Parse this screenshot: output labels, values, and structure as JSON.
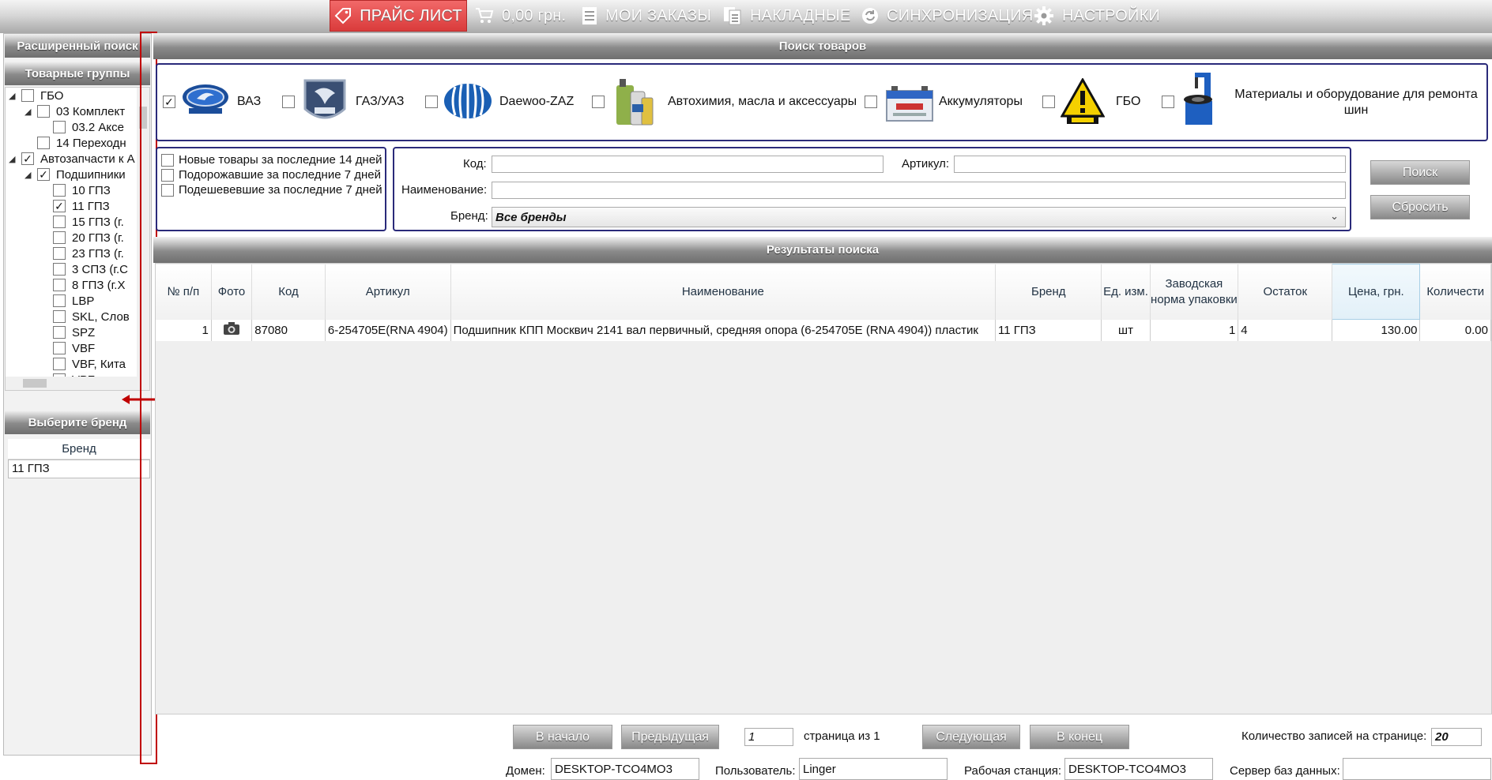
{
  "nav": {
    "price_list": "ПРАЙС ЛИСТ",
    "cart_total": "0,00 грн.",
    "my_orders": "МОИ ЗАКАЗЫ",
    "invoices": "НАКЛАДНЫЕ",
    "sync": "СИНХРОНИЗАЦИЯ",
    "settings": "НАСТРОЙКИ"
  },
  "left": {
    "advanced_search": "Расширенный поиск",
    "product_groups": "Товарные группы",
    "tree": [
      {
        "label": "ГБО",
        "checked": false,
        "expand": "open"
      },
      {
        "label": "03 Комплект",
        "checked": false,
        "expand": "open"
      },
      {
        "label": "03.2 Аксе",
        "checked": false,
        "expand": ""
      },
      {
        "label": "14 Переходн",
        "checked": false,
        "expand": ""
      },
      {
        "label": "Автозапчасти к А",
        "checked": true,
        "expand": "open"
      },
      {
        "label": "Подшипники",
        "checked": true,
        "expand": "open"
      },
      {
        "label": "10 ГПЗ",
        "checked": false,
        "expand": ""
      },
      {
        "label": "11 ГПЗ",
        "checked": true,
        "expand": ""
      },
      {
        "label": "15 ГПЗ (г.",
        "checked": false,
        "expand": ""
      },
      {
        "label": "20 ГПЗ (г.",
        "checked": false,
        "expand": ""
      },
      {
        "label": "23 ГПЗ (г.",
        "checked": false,
        "expand": ""
      },
      {
        "label": "3 СПЗ (г.С",
        "checked": false,
        "expand": ""
      },
      {
        "label": "8 ГПЗ (г.Х",
        "checked": false,
        "expand": ""
      },
      {
        "label": "LBP",
        "checked": false,
        "expand": ""
      },
      {
        "label": "SKL, Слов",
        "checked": false,
        "expand": ""
      },
      {
        "label": "SPZ",
        "checked": false,
        "expand": ""
      },
      {
        "label": "VBF",
        "checked": false,
        "expand": ""
      },
      {
        "label": "VBF, Кита",
        "checked": false,
        "expand": ""
      },
      {
        "label": "VPZ",
        "checked": false,
        "expand": ""
      }
    ],
    "choose_brand": "Выберите бренд",
    "brand_col": "Бренд",
    "brand_selected": "11 ГПЗ"
  },
  "search": {
    "header": "Поиск товаров",
    "categories": [
      {
        "label": "ВАЗ",
        "checked": true,
        "icon": "lada-logo"
      },
      {
        "label": "ГАЗ/УАЗ",
        "checked": false,
        "icon": "gaz-logo"
      },
      {
        "label": "Daewoo-ZAZ",
        "checked": false,
        "icon": "daewoo-logo"
      },
      {
        "label": "Автохимия, масла и аксессуары",
        "checked": false,
        "icon": "oil-bottles"
      },
      {
        "label": "Аккумуляторы",
        "checked": false,
        "icon": "battery"
      },
      {
        "label": "ГБО",
        "checked": false,
        "icon": "gas-warning-sign"
      },
      {
        "label": "Материалы и оборудование для ремонта шин",
        "checked": false,
        "icon": "tire-changer"
      }
    ],
    "filters": [
      "Новые товары за последние 14 дней",
      "Подорожавшие за последние 7 дней",
      "Подешевевшие за последние 7 дней"
    ],
    "code_label": "Код:",
    "article_label": "Артикул:",
    "name_label": "Наименование:",
    "brand_label": "Бренд:",
    "brand_value": "Все бренды",
    "search_btn": "Поиск",
    "reset_btn": "Сбросить"
  },
  "results": {
    "header": "Результаты поиска",
    "columns": [
      "№ п/п",
      "Фото",
      "Код",
      "Артикул",
      "Наименование",
      "Бренд",
      "Ед. изм.",
      "Заводская норма упаковки",
      "Остаток",
      "Цена, грн.",
      "Количести"
    ],
    "rows": [
      {
        "num": "1",
        "code": "87080",
        "article": "6-254705E(RNA 4904)",
        "name": "Подшипник КПП Москвич 2141 вал первичный, средняя опора (6-254705E (RNA 4904)) пластик",
        "brand": "11 ГПЗ",
        "unit": "шт",
        "pack": "1",
        "stock": "4",
        "price": "130.00",
        "qty": "0.00"
      }
    ]
  },
  "pager": {
    "first": "В начало",
    "prev": "Предыдущая",
    "page": "1",
    "page_of": "страница из 1",
    "next": "Следующая",
    "last": "В конец",
    "per_page_label": "Количество записей на странице:",
    "per_page": "20"
  },
  "status": {
    "domain_label": "Домен:",
    "domain": "DESKTOP-TCO4MO3",
    "user_label": "Пользователь:",
    "user": "Linger",
    "ws_label": "Рабочая станция:",
    "ws": "DESKTOP-TCO4MO3",
    "db_label": "Сервер баз данных:",
    "db": ""
  }
}
